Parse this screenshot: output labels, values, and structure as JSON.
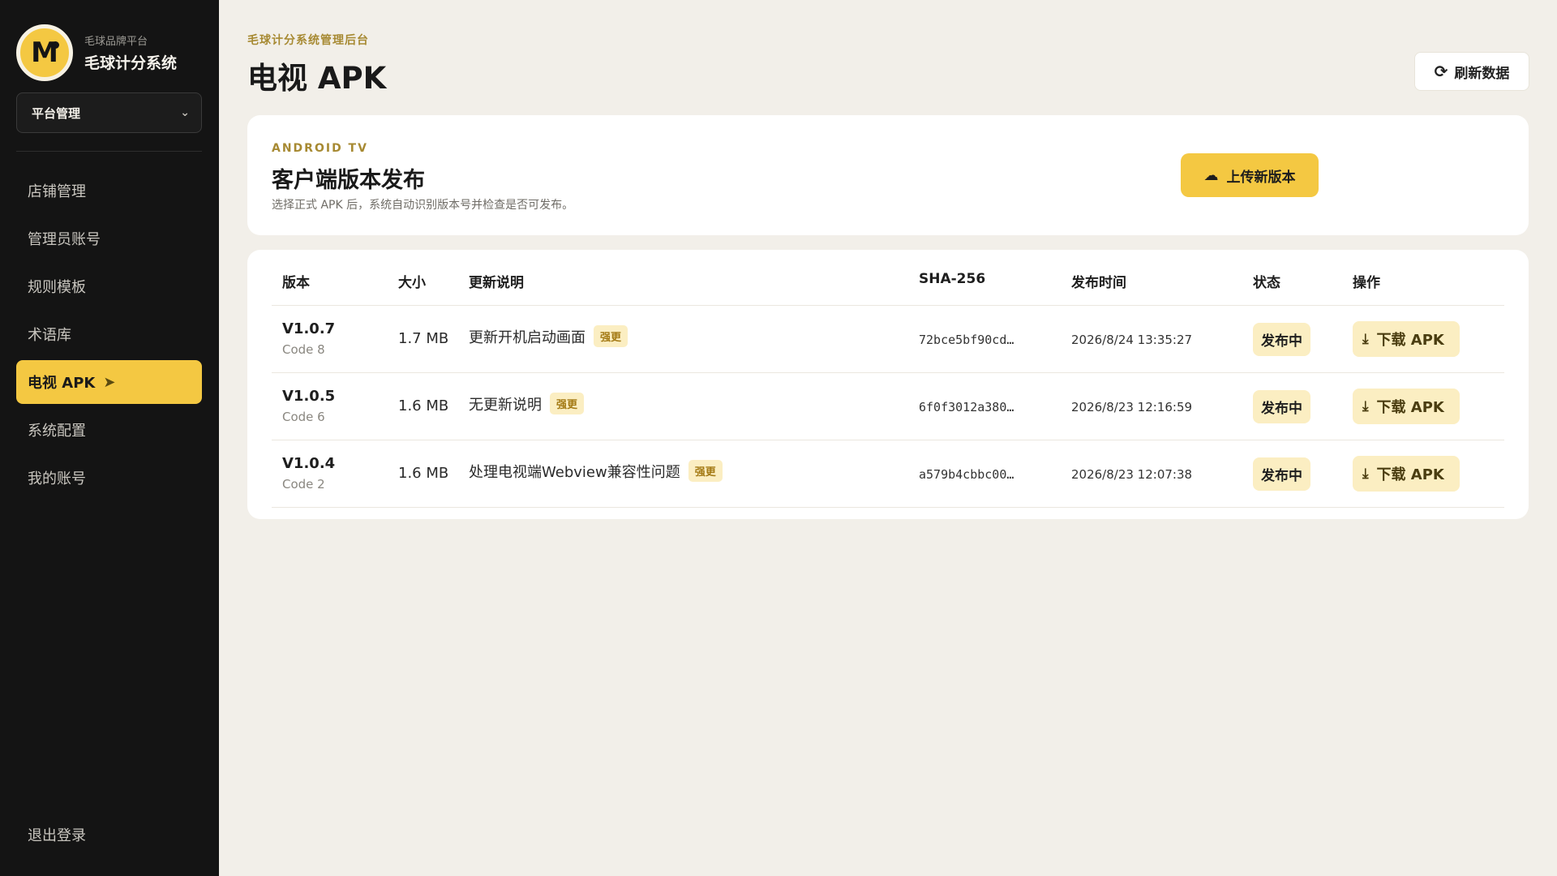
{
  "brand": {
    "logo_letter": "M",
    "subtitle": "毛球品牌平台",
    "name": "毛球计分系统"
  },
  "platform_select": {
    "value": "平台管理"
  },
  "nav": [
    {
      "label": "店铺管理",
      "active": false
    },
    {
      "label": "管理员账号",
      "active": false
    },
    {
      "label": "规则模板",
      "active": false
    },
    {
      "label": "术语库",
      "active": false
    },
    {
      "label": "电视 APK",
      "active": true
    },
    {
      "label": "系统配置",
      "active": false
    },
    {
      "label": "我的账号",
      "active": false
    }
  ],
  "logout_label": "退出登录",
  "header": {
    "eyebrow": "毛球计分系统管理后台",
    "title": "电视 APK",
    "refresh_label": "刷新数据"
  },
  "publish": {
    "eyebrow": "ANDROID TV",
    "title": "客户端版本发布",
    "description": "选择正式 APK 后，系统自动识别版本号并检查是否可发布。",
    "upload_label": "上传新版本"
  },
  "table": {
    "columns": [
      "版本",
      "大小",
      "更新说明",
      "SHA-256",
      "发布时间",
      "状态",
      "操作"
    ],
    "rows": [
      {
        "version": "V1.0.7",
        "code": "Code 8",
        "size": "1.7 MB",
        "note": "更新开机启动画面",
        "badge": "强更",
        "sha": "72bce5bf90cd…",
        "time": "2026/8/24 13:35:27",
        "status": "发布中",
        "action": "下载 APK"
      },
      {
        "version": "V1.0.5",
        "code": "Code 6",
        "size": "1.6 MB",
        "note": "无更新说明",
        "badge": "强更",
        "sha": "6f0f3012a380…",
        "time": "2026/8/23 12:16:59",
        "status": "发布中",
        "action": "下载 APK"
      },
      {
        "version": "V1.0.4",
        "code": "Code 2",
        "size": "1.6 MB",
        "note": "处理电视端Webview兼容性问题",
        "badge": "强更",
        "sha": "a579b4cbbc00…",
        "time": "2026/8/23 12:07:38",
        "status": "发布中",
        "action": "下载 APK"
      }
    ]
  },
  "colors": {
    "accent": "#f4c842",
    "sidebar_bg": "#141414",
    "page_bg": "#f2efe9",
    "badge_bg": "#fbeec2"
  }
}
